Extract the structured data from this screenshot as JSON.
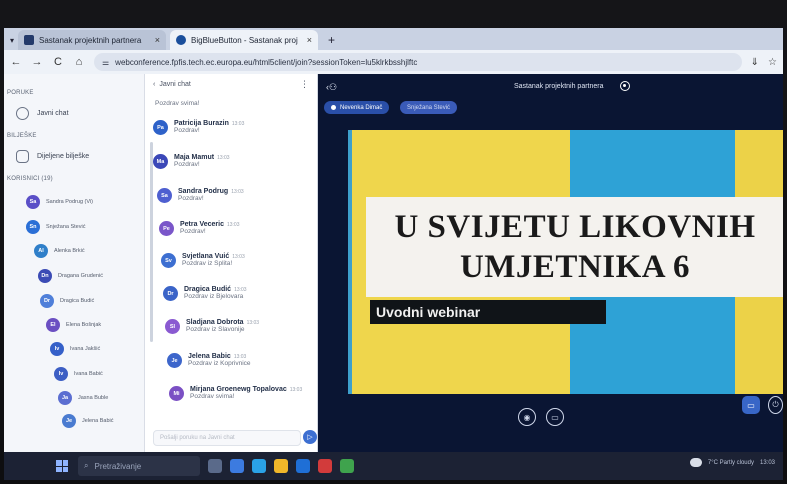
{
  "browser": {
    "tabs": [
      {
        "title": "Sastanak projektnih partnera",
        "close": "×"
      },
      {
        "title": "BigBlueButton - Sastanak proj",
        "close": "×"
      }
    ],
    "new_tab": "+",
    "url": "webconference.fpfis.tech.ec.europa.eu/html5client/join?sessionToken=lu5klrkbsshjlftc"
  },
  "sidebar": {
    "messages_label": "PORUKE",
    "public_chat_label": "Javni chat",
    "notes_label": "BILJEŠKE",
    "shared_notes_label": "Dijeljene bilješke",
    "users_label": "KORISNICI (19)",
    "users": [
      {
        "initials": "Sa",
        "name": "Sandra Podrug (Vi)",
        "color": "#5a4fc7"
      },
      {
        "initials": "Sn",
        "name": "Snježana Stević",
        "color": "#2b6fd6"
      },
      {
        "initials": "Al",
        "name": "Alenka Brkić",
        "color": "#2f7fc9"
      },
      {
        "initials": "Dn",
        "name": "Dragana Grudenić",
        "color": "#3b4bb5"
      },
      {
        "initials": "Dr",
        "name": "Dragica Budić",
        "color": "#4f7fd9"
      },
      {
        "initials": "El",
        "name": "Elena Bošnjak",
        "color": "#6b4fc2"
      },
      {
        "initials": "Iv",
        "name": "Ivana Jakšić",
        "color": "#3560c9"
      },
      {
        "initials": "Iv",
        "name": "Ivana Babić",
        "color": "#3c5ec4"
      },
      {
        "initials": "Ja",
        "name": "Jasna Buble",
        "color": "#5b6ed1"
      },
      {
        "initials": "Je",
        "name": "Jelena Babić",
        "color": "#4a7bd0"
      }
    ]
  },
  "chat": {
    "header": "Javni chat",
    "back": "‹",
    "messages": [
      {
        "initials": "",
        "name": "",
        "time": "",
        "text": "Pozdrav svima!",
        "color": "#3a5cc4"
      },
      {
        "initials": "Pa",
        "name": "Patricija Burazin",
        "time": "13:03",
        "text": "Pozdrav!",
        "color": "#2e62c9"
      },
      {
        "initials": "Ma",
        "name": "Maja Mamut",
        "time": "13:03",
        "text": "Pozdrav!",
        "color": "#3b48b8"
      },
      {
        "initials": "Sa",
        "name": "Sandra Podrug",
        "time": "13:03",
        "text": "Pozdrav!",
        "color": "#4e5fd0"
      },
      {
        "initials": "Pe",
        "name": "Petra Veceric",
        "time": "13:03",
        "text": "Pozdrav!",
        "color": "#7a56c9"
      },
      {
        "initials": "Sv",
        "name": "Svjetlana Vuić",
        "time": "13:03",
        "text": "Pozdrav iz Splita!",
        "color": "#3d6fd1"
      },
      {
        "initials": "Dr",
        "name": "Dragica Budić",
        "time": "13:03",
        "text": "Pozdrav iz Bjelovara",
        "color": "#3b64c8"
      },
      {
        "initials": "Sl",
        "name": "Sladjana Dobrota",
        "time": "13:03",
        "text": "Pozdrav iz Slavonije",
        "color": "#8a5ad1"
      },
      {
        "initials": "Je",
        "name": "Jelena Babic",
        "time": "13:03",
        "text": "Pozdrav iz Koprivnice",
        "color": "#3d66cb"
      },
      {
        "initials": "Mi",
        "name": "Mirjana Groenewg Topalovac",
        "time": "13:03",
        "text": "Pozdrav svima!",
        "color": "#7b50c4"
      }
    ],
    "input_placeholder": "Pošalji poruku na Javni chat",
    "send": "▷"
  },
  "presentation": {
    "title": "Sastanak projektnih partnera",
    "talkers": [
      "Nevenka Dimač",
      "Snježana Stević"
    ],
    "slide_title_line1": "U SVIJETU LIKOVNIH",
    "slide_title_line2": "UMJETNIKA 6",
    "slide_subtitle": "Uvodni webinar"
  },
  "taskbar": {
    "search_placeholder": "Pretraživanje",
    "weather": "7°C  Partly cloudy",
    "clock": "13:03"
  }
}
